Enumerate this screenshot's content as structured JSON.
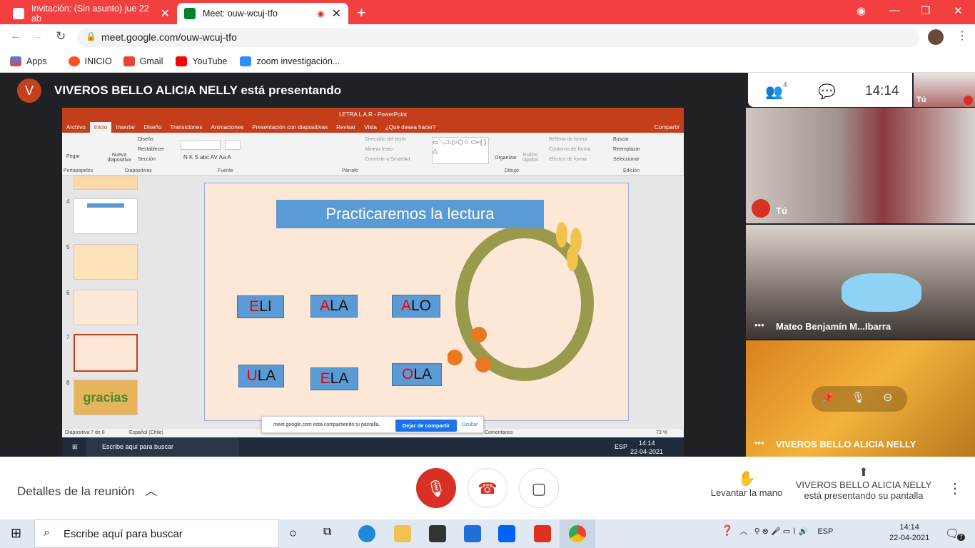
{
  "browser": {
    "tabs": [
      {
        "title": "Invitación: (Sin asunto) jue 22 ab"
      },
      {
        "title": "Meet: ouw-wcuj-tfo"
      }
    ],
    "url": "meet.google.com/ouw-wcuj-tfo",
    "bookmarks": [
      "Apps",
      "INICIO",
      "Gmail",
      "YouTube",
      "zoom investigación..."
    ]
  },
  "meet": {
    "presenter_initial": "V",
    "presenter_banner": "VIVEROS BELLO ALICIA NELLY está presentando",
    "participants_count": "4",
    "time": "14:14",
    "self_thumb_label": "Tú",
    "tiles": [
      {
        "name": "Tú"
      },
      {
        "name": "Mateo Benjamín M...Ibarra"
      },
      {
        "name": "VIVEROS BELLO ALICIA NELLY"
      }
    ],
    "details": "Detalles de la reunión",
    "raise_hand": "Levantar la mano",
    "presenting_line1": "VIVEROS BELLO ALICIA NELLY",
    "presenting_line2": "está presentando su pantalla"
  },
  "ppt": {
    "title": "LETRA L A.R - PowerPoint",
    "menu": [
      "Archivo",
      "Inicio",
      "Insertar",
      "Diseño",
      "Transiciones",
      "Animaciones",
      "Presentación con diapositivas",
      "Revisar",
      "Vista",
      "¿Qué desea hacer?",
      "Compartir"
    ],
    "groups": [
      "Portapapeles",
      "Diapositivas",
      "Fuente",
      "Párrafo",
      "Dibujo",
      "Edición"
    ],
    "ribbon": {
      "pegar": "Pegar",
      "nueva": "Nueva diapositiva",
      "diseno": "Diseño",
      "restablecer": "Restablecer",
      "seccion": "Sección",
      "direccion": "Dirección del texto",
      "alinear": "Alinear texto",
      "smartart": "Convertir a SmartArt",
      "organizar": "Organizar",
      "estilos": "Estilos rápidos",
      "relleno": "Relleno de forma",
      "contorno": "Contorno de forma",
      "efectos": "Efectos de forma",
      "buscar": "Buscar",
      "reemplazar": "Reemplazar",
      "seleccionar": "Seleccionar"
    },
    "thumb_numbers": [
      "4",
      "5",
      "6",
      "7",
      "8"
    ],
    "thumb8_text": "gracias",
    "slide_title": "Practicaremos la lectura",
    "syllables": [
      {
        "first": "E",
        "rest": "LI"
      },
      {
        "first": "A",
        "rest": "LA"
      },
      {
        "first": "A",
        "rest": "LO"
      },
      {
        "first": "U",
        "rest": "LA"
      },
      {
        "first": "E",
        "rest": "LA"
      },
      {
        "first": "O",
        "rest": "LA"
      }
    ],
    "status_left": "Diapositiva 7 de 8",
    "status_lang": "Español (Chile)",
    "status_comments": "Comentarios",
    "zoom": "73 %"
  },
  "share_bar": {
    "text": "meet.google.com está compartiendo tu pantalla.",
    "stop": "Dejar de compartir",
    "hide": "Ocultar"
  },
  "inner_taskbar": {
    "search": "Escribe aquí para buscar",
    "lang": "ESP",
    "time": "14:14",
    "date": "22-04-2021"
  },
  "taskbar": {
    "search": "Escribe aquí para buscar",
    "lang": "ESP",
    "time": "14:14",
    "date": "22-04-2021",
    "notif": "7"
  },
  "colors": {
    "chrome_red": "#f23f3f",
    "ppt_orange": "#c43e1c",
    "slide_blue": "#5b9bd5",
    "meet_dark": "#202124",
    "end_red": "#d93025"
  }
}
